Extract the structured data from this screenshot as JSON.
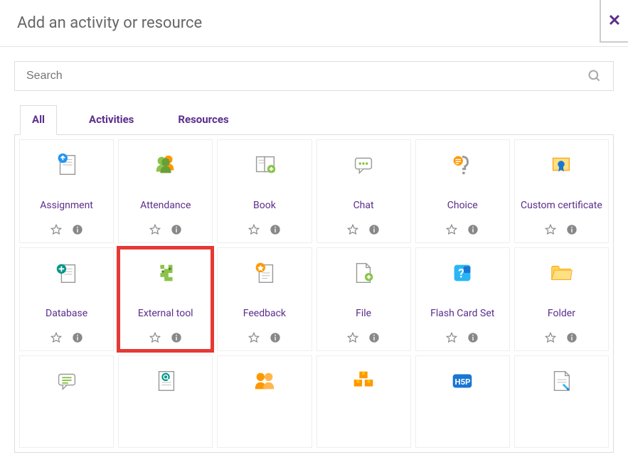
{
  "modal": {
    "title": "Add an activity or resource"
  },
  "search": {
    "placeholder": "Search"
  },
  "tabs": {
    "all": "All",
    "activities": "Activities",
    "resources": "Resources"
  },
  "items": [
    {
      "label": "Assignment",
      "icon": "assignment",
      "highlighted": false
    },
    {
      "label": "Attendance",
      "icon": "attendance",
      "highlighted": false
    },
    {
      "label": "Book",
      "icon": "book",
      "highlighted": false
    },
    {
      "label": "Chat",
      "icon": "chat",
      "highlighted": false
    },
    {
      "label": "Choice",
      "icon": "choice",
      "highlighted": false
    },
    {
      "label": "Custom certificate",
      "icon": "certificate",
      "highlighted": false
    },
    {
      "label": "Database",
      "icon": "database",
      "highlighted": false
    },
    {
      "label": "External tool",
      "icon": "externaltool",
      "highlighted": true
    },
    {
      "label": "Feedback",
      "icon": "feedback",
      "highlighted": false
    },
    {
      "label": "File",
      "icon": "file",
      "highlighted": false
    },
    {
      "label": "Flash Card Set",
      "icon": "flashcard",
      "highlighted": false
    },
    {
      "label": "Folder",
      "icon": "folder",
      "highlighted": false
    },
    {
      "label": "",
      "icon": "forum",
      "highlighted": false
    },
    {
      "label": "",
      "icon": "glossary",
      "highlighted": false
    },
    {
      "label": "",
      "icon": "group",
      "highlighted": false
    },
    {
      "label": "",
      "icon": "packages",
      "highlighted": false
    },
    {
      "label": "",
      "icon": "h5p",
      "highlighted": false
    },
    {
      "label": "",
      "icon": "page",
      "highlighted": false
    }
  ]
}
